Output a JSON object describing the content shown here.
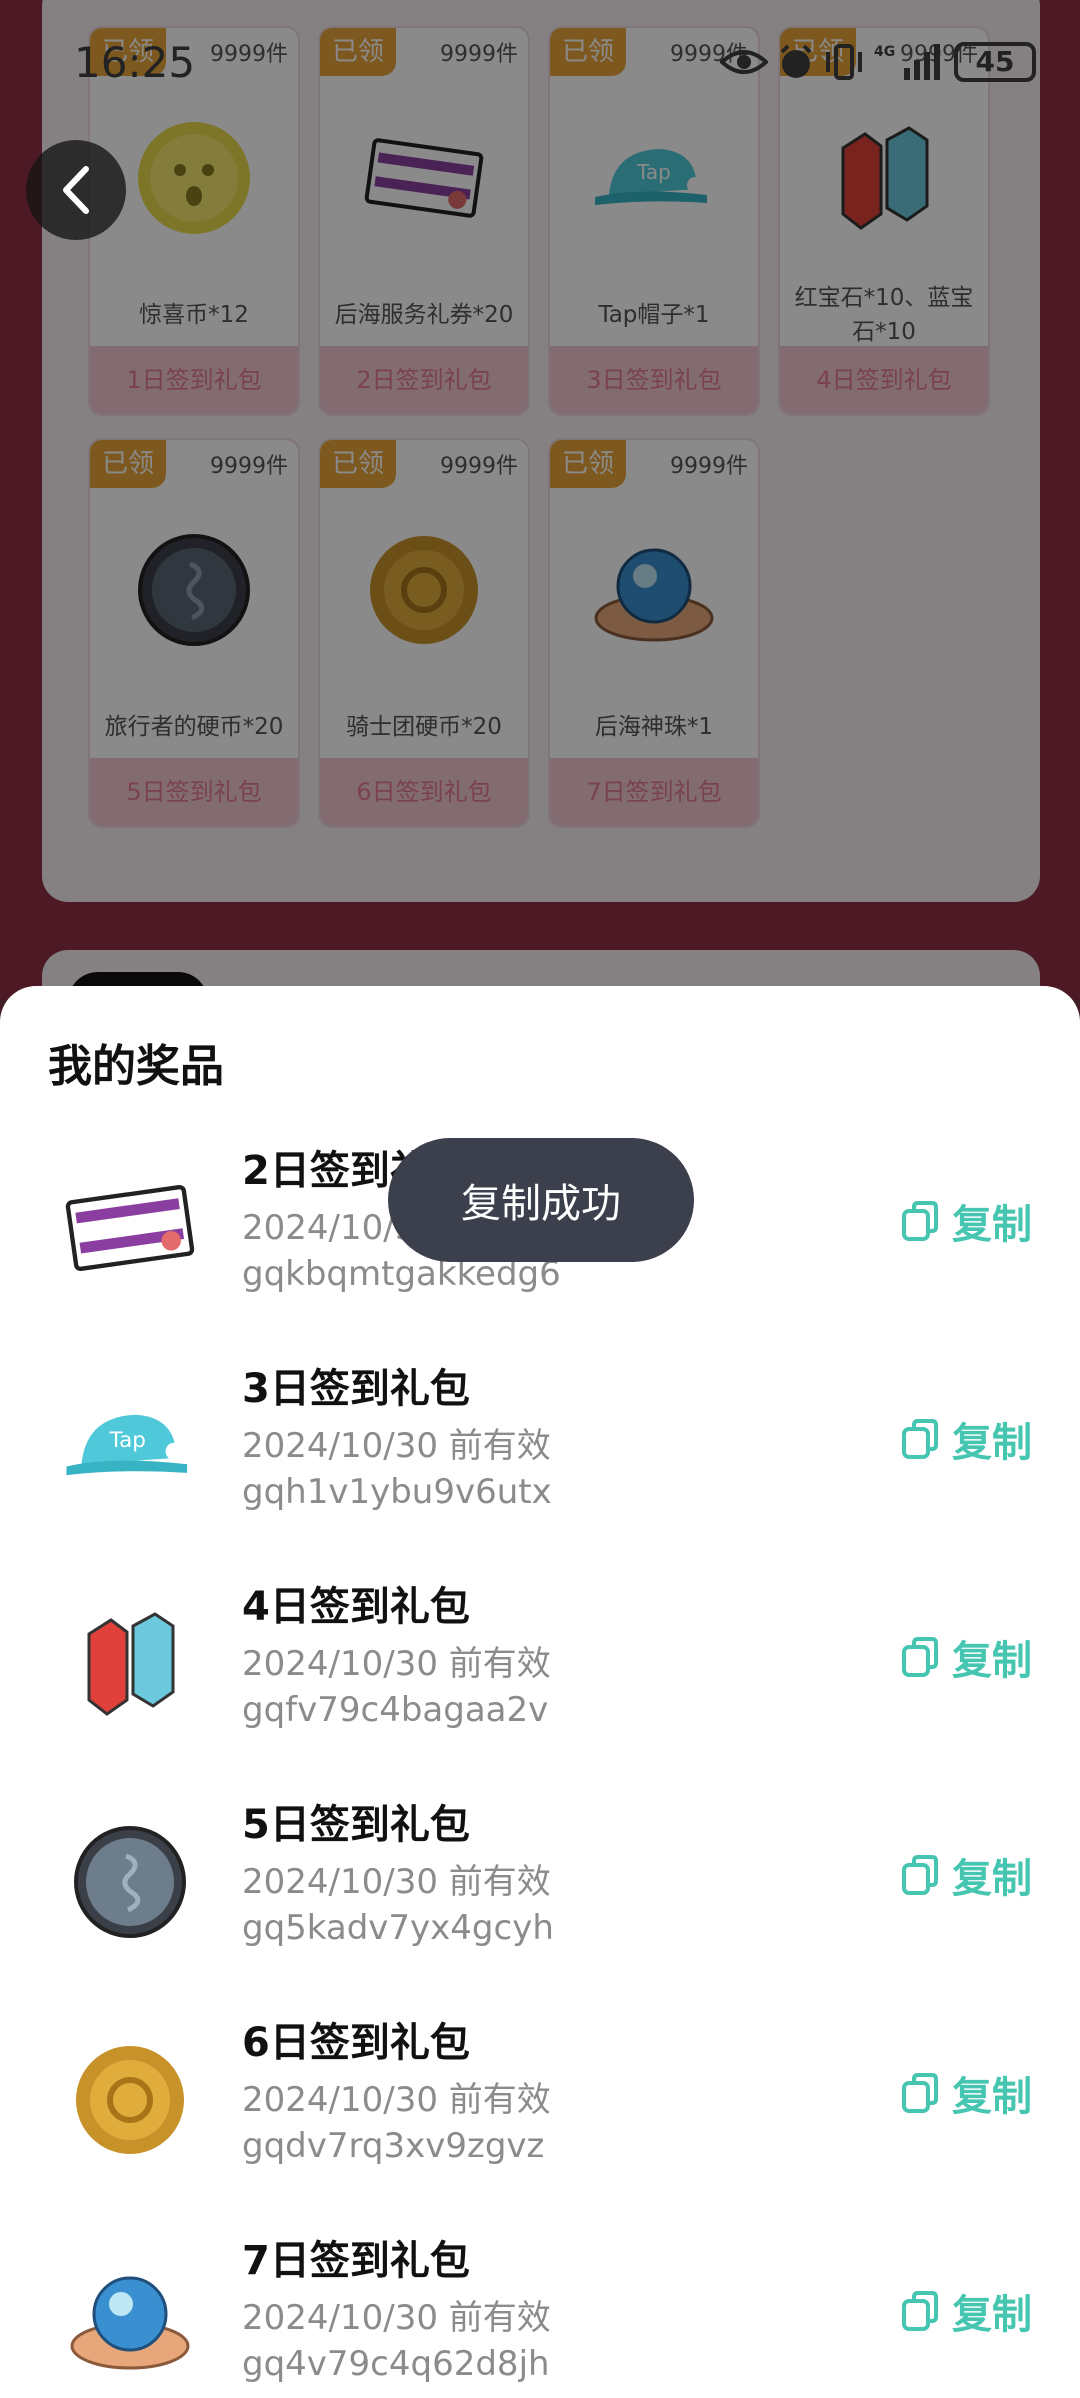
{
  "status_bar": {
    "time": "16:25",
    "battery": "45"
  },
  "background_gifts": [
    {
      "tag": "已领",
      "stock": "9999件",
      "name": "惊喜币*12",
      "foot": "1日签到礼包",
      "icon": "coin-gold-face"
    },
    {
      "tag": "已领",
      "stock": "9999件",
      "name": "后海服务礼券*20",
      "foot": "2日签到礼包",
      "icon": "voucher-card"
    },
    {
      "tag": "已领",
      "stock": "9999件",
      "name": "Tap帽子*1",
      "foot": "3日签到礼包",
      "icon": "tap-cap"
    },
    {
      "tag": "已领",
      "stock": "9999件",
      "name": "红宝石*10、蓝宝石*10",
      "foot": "4日签到礼包",
      "icon": "gems"
    },
    {
      "tag": "已领",
      "stock": "9999件",
      "name": "旅行者的硬币*20",
      "foot": "5日签到礼包",
      "icon": "coin-dark"
    },
    {
      "tag": "已领",
      "stock": "9999件",
      "name": "骑士团硬币*20",
      "foot": "6日签到礼包",
      "icon": "coin-bronze"
    },
    {
      "tag": "已领",
      "stock": "9999件",
      "name": "后海神珠*1",
      "foot": "7日签到礼包",
      "icon": "orb"
    }
  ],
  "sheet": {
    "title": "我的奖品",
    "copy_label": "复制",
    "prizes": [
      {
        "title": "2日签到礼包",
        "valid": "2024/10/30 前有效",
        "code": "gqkbqmtgakkedg6",
        "icon": "voucher-card"
      },
      {
        "title": "3日签到礼包",
        "valid": "2024/10/30 前有效",
        "code": "gqh1v1ybu9v6utx",
        "icon": "tap-cap"
      },
      {
        "title": "4日签到礼包",
        "valid": "2024/10/30 前有效",
        "code": "gqfv79c4bagaa2v",
        "icon": "gems"
      },
      {
        "title": "5日签到礼包",
        "valid": "2024/10/30 前有效",
        "code": "gq5kadv7yx4gcyh",
        "icon": "coin-dark"
      },
      {
        "title": "6日签到礼包",
        "valid": "2024/10/30 前有效",
        "code": "gqdv7rq3xv9zgvz",
        "icon": "coin-bronze"
      },
      {
        "title": "7日签到礼包",
        "valid": "2024/10/30 前有效",
        "code": "gq4v79c4q62d8jh",
        "icon": "orb"
      }
    ]
  },
  "toast": {
    "text": "复制成功"
  },
  "colors": {
    "accent": "#46c6b0",
    "tag": "#e9a43a",
    "foot_bg": "#f3c7d1",
    "toast_bg": "#3c3f4c"
  }
}
